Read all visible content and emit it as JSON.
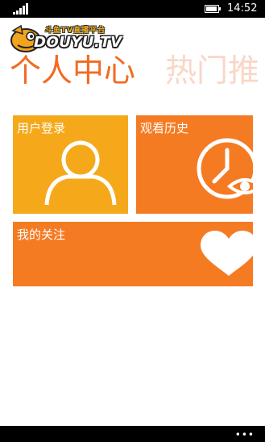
{
  "status_bar": {
    "time": "14:52",
    "signal_bars": 5,
    "battery_level": 0.85
  },
  "logo": {
    "text": "DOUYU.TV",
    "tagline": "斗鱼TV直播平台"
  },
  "pivot": {
    "active": "个人中心",
    "next": "热门推"
  },
  "tiles": {
    "login": {
      "label": "用户登录",
      "icon": "user-icon"
    },
    "history": {
      "label": "观看历史",
      "icon": "clock-eye-icon"
    },
    "follow": {
      "label": "我的关注",
      "icon": "heart-icon"
    }
  },
  "app_bar": {
    "more": "•••"
  },
  "colors": {
    "accent": "#f26b22",
    "tile_yellow": "#f5a91a",
    "tile_orange": "#f57b23",
    "pivot_inactive": "#f9d7c8"
  }
}
